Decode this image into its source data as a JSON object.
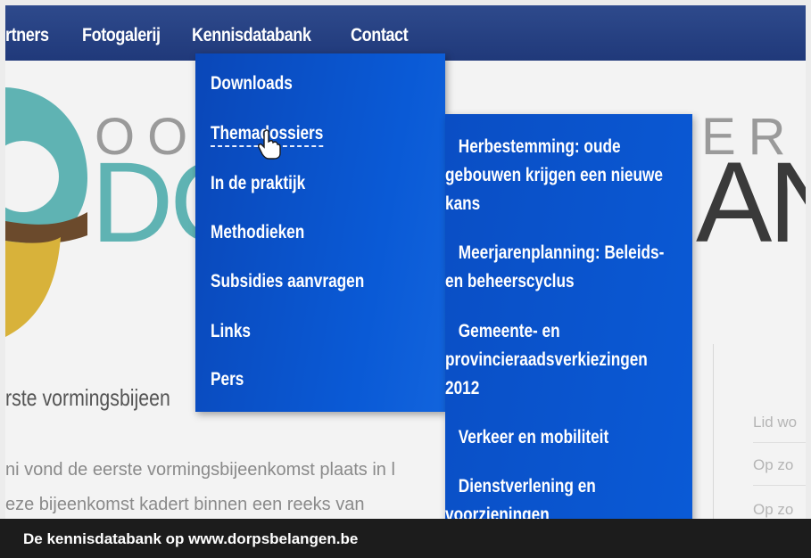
{
  "nav": {
    "items": [
      "rtners",
      "Fotogalerij",
      "Kennisdatabank",
      "Contact"
    ]
  },
  "logo_text": {
    "top_left": "OO",
    "top_right": "ER",
    "big_left": "DO",
    "big_right": "AN"
  },
  "dropdown": {
    "items": [
      "Downloads",
      "Themadossiers",
      "In de praktijk",
      "Methodieken",
      "Subsidies aanvragen",
      "Links",
      "Pers"
    ],
    "active_index": 1
  },
  "submenu": {
    "items": [
      "Herbestemming: oude gebouwen krijgen een nieuwe kans",
      "Meerjarenplanning: Beleids- en beheerscyclus",
      "Gemeente- en provincieraadsverkiezingen 2012",
      "Verkeer en mobiliteit",
      "Dienstverlening en voorzieningen"
    ]
  },
  "content": {
    "post_title": "rste vormingsbijeen",
    "body_lines": [
      "ni vond de eerste vormingsbijeenkomst plaats in l",
      "eze bijeenkomst kadert binnen een reeks van"
    ]
  },
  "sidebar": {
    "links": [
      "Lid wo",
      "Op zo",
      "Op zo"
    ]
  },
  "caption": "De kennisdatabank op www.dorpsbelangen.be",
  "colors": {
    "navbar": "#20397a",
    "dropdown": "#0a5ad6",
    "logo_teal": "#5fb3b3",
    "logo_brown": "#6b4a2c",
    "logo_yellow": "#d8b23a"
  }
}
